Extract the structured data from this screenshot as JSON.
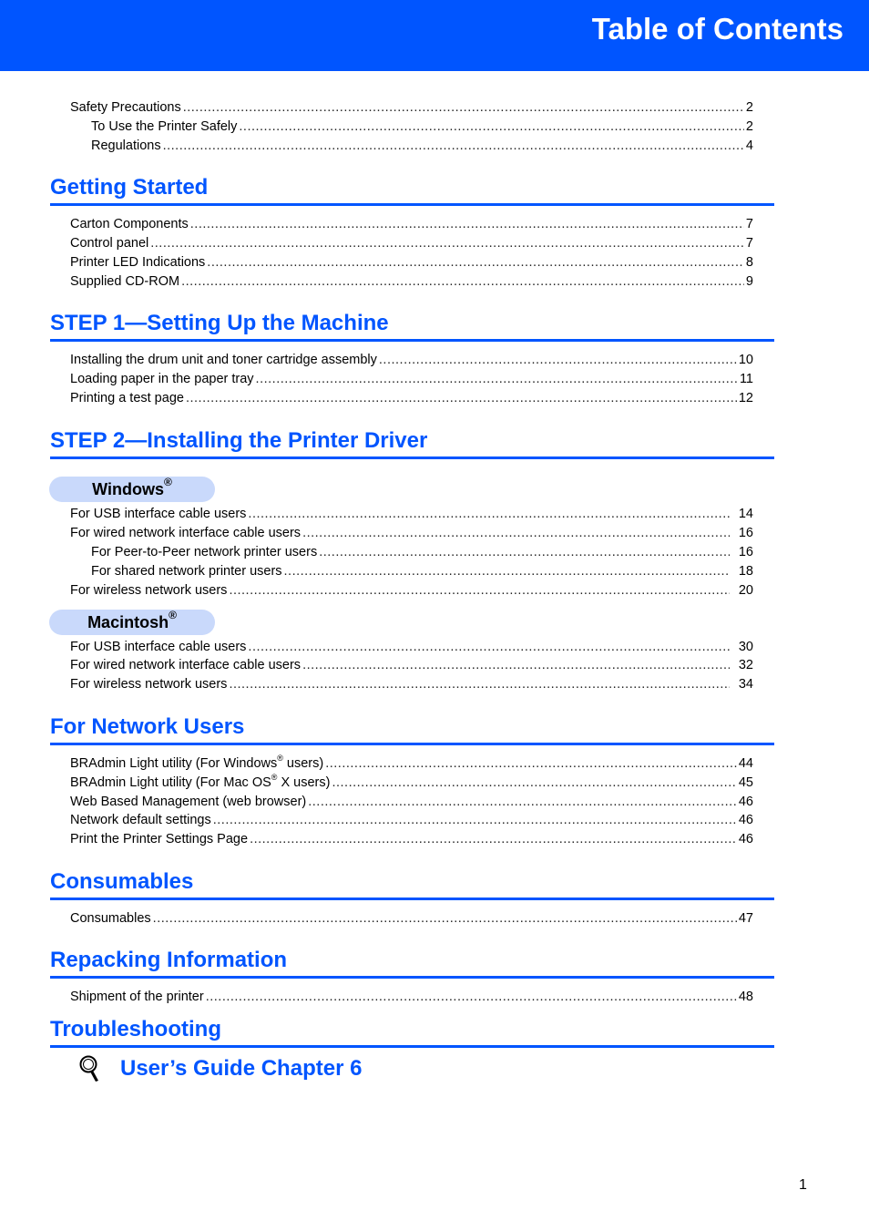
{
  "header": {
    "title": "Table of Contents"
  },
  "intro": [
    {
      "label": "Safety Precautions",
      "page": "2",
      "indent": false
    },
    {
      "label": "To Use the Printer Safely",
      "page": "2",
      "indent": true
    },
    {
      "label": "Regulations",
      "page": "4",
      "indent": true
    }
  ],
  "sections": {
    "getting_started": {
      "title": "Getting Started",
      "items": [
        {
          "label": "Carton Components",
          "page": "7"
        },
        {
          "label": "Control panel",
          "page": "7"
        },
        {
          "label": "Printer LED Indications",
          "page": "8"
        },
        {
          "label": "Supplied CD-ROM",
          "page": "9"
        }
      ]
    },
    "step1": {
      "title": "STEP 1—Setting Up the Machine",
      "items": [
        {
          "label": "Installing the drum unit and toner cartridge assembly",
          "page": "10"
        },
        {
          "label": "Loading paper in the paper tray",
          "page": "11"
        },
        {
          "label": "Printing a test page",
          "page": "12"
        }
      ]
    },
    "step2": {
      "title": "STEP 2—Installing the Printer Driver",
      "windows": {
        "label": "Windows",
        "mark": "®",
        "items": [
          {
            "label": "For USB interface cable users",
            "page": "14"
          },
          {
            "label": "For wired network interface cable users",
            "page": "16"
          },
          {
            "label": "For Peer-to-Peer network printer users",
            "page": "16"
          },
          {
            "label": "For shared network printer users",
            "page": "18"
          },
          {
            "label": "For wireless network users",
            "page": "20"
          }
        ]
      },
      "macintosh": {
        "label": "Macintosh",
        "mark": "®",
        "items": [
          {
            "label": "For USB interface cable users",
            "page": "30"
          },
          {
            "label": "For wired network interface cable users",
            "page": "32"
          },
          {
            "label": "For wireless network users",
            "page": "34"
          }
        ]
      }
    },
    "network": {
      "title": "For Network Users",
      "items": [
        {
          "label_a": "BRAdmin Light utility (For Windows",
          "mark": "®",
          "label_b": " users)",
          "page": "44"
        },
        {
          "label_a": "BRAdmin Light utility (For Mac OS",
          "mark": "®",
          "label_b": " X users)",
          "page": "45"
        },
        {
          "label": "Web Based Management (web browser)",
          "page": "46"
        },
        {
          "label": "Network default settings",
          "page": "46"
        },
        {
          "label": "Print the Printer Settings Page",
          "page": "46"
        }
      ]
    },
    "consumables": {
      "title": "Consumables",
      "items": [
        {
          "label": "Consumables",
          "page": "47"
        }
      ]
    },
    "repacking": {
      "title": "Repacking Information",
      "items": [
        {
          "label": "Shipment of the printer",
          "page": "48"
        }
      ]
    },
    "troubleshooting": {
      "title": "Troubleshooting",
      "reference": "User’s Guide Chapter 6",
      "reference_icon": "magnifier-icon"
    }
  },
  "footer": {
    "page_number": "1"
  },
  "colors": {
    "brand_blue": "#0055ff",
    "pill_blue": "#c9d9fb"
  }
}
